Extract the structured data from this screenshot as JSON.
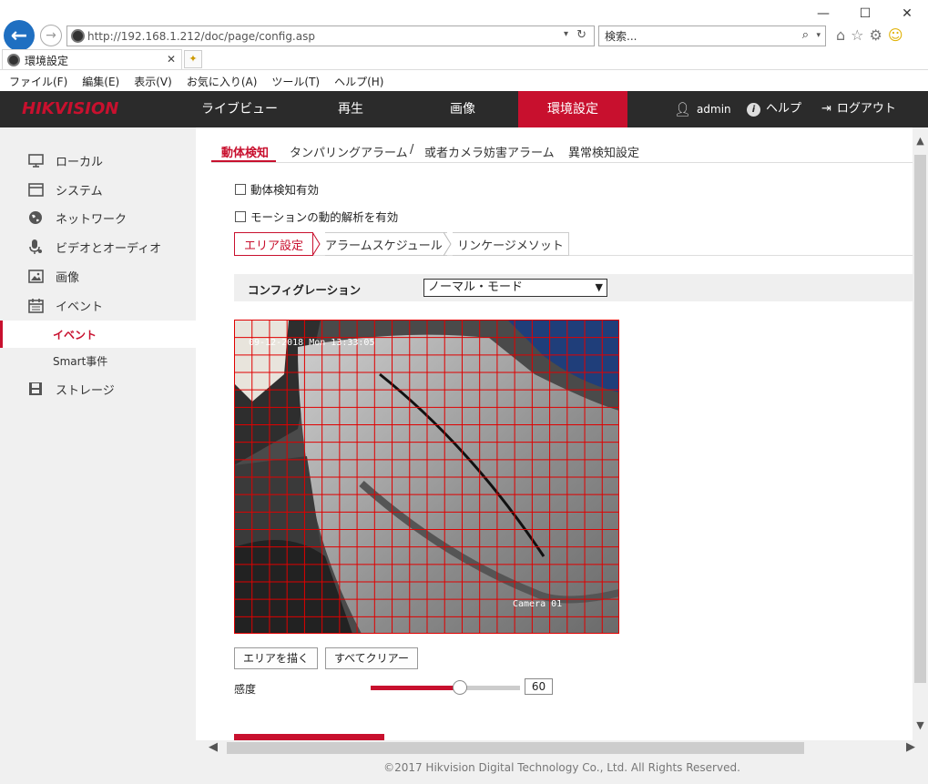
{
  "browser": {
    "address": "http://192.168.1.212/doc/page/config.asp",
    "search_placeholder": "検索...",
    "tab_title": "環境設定",
    "menu": [
      "ファイル(F)",
      "編集(E)",
      "表示(V)",
      "お気に入り(A)",
      "ツール(T)",
      "ヘルプ(H)"
    ]
  },
  "header": {
    "logo_part1": "HIK",
    "logo_part2": "VISION",
    "nav": [
      "ライブビュー",
      "再生",
      "画像",
      "環境設定"
    ],
    "active_nav": "環境設定",
    "user": "admin",
    "help": "ヘルプ",
    "logout": "ログアウト"
  },
  "sidebar": {
    "items": [
      {
        "label": "ローカル",
        "icon": "monitor-icon"
      },
      {
        "label": "システム",
        "icon": "window-icon"
      },
      {
        "label": "ネットワーク",
        "icon": "globe-icon"
      },
      {
        "label": "ビデオとオーディオ",
        "icon": "microphone-icon"
      },
      {
        "label": "画像",
        "icon": "image-icon"
      },
      {
        "label": "イベント",
        "icon": "calendar-icon"
      }
    ],
    "subitems": [
      "イベント",
      "Smart事件"
    ],
    "storage": {
      "label": "ストレージ",
      "icon": "disk-icon"
    }
  },
  "content": {
    "subtabs": [
      "動体検知",
      "タンパリングアラーム",
      "/",
      "或者カメラ妨害アラーム",
      "異常検知設定"
    ],
    "checkbox1": "動体検知有効",
    "checkbox2": "モーションの動的解析を有効",
    "crumbs": [
      "エリア設定",
      "アラームスケジュール",
      "リンケージメソット"
    ],
    "config_label": "コンフィグレーション",
    "config_value": "ノーマル・モード",
    "video_timestamp": "09-12-2018 Mon 13:33:05",
    "video_camera": "Camera 01",
    "draw_area": "エリアを描く",
    "clear_all": "すべてクリアー",
    "sensitivity_label": "感度",
    "sensitivity_value": "60",
    "sensitivity_level": 0.6
  },
  "footer": "©2017 Hikvision Digital Technology Co., Ltd. All Rights Reserved.",
  "colors": {
    "accent": "#c8102e",
    "header_bg": "#2b2b2b",
    "grid": "#e00000"
  }
}
